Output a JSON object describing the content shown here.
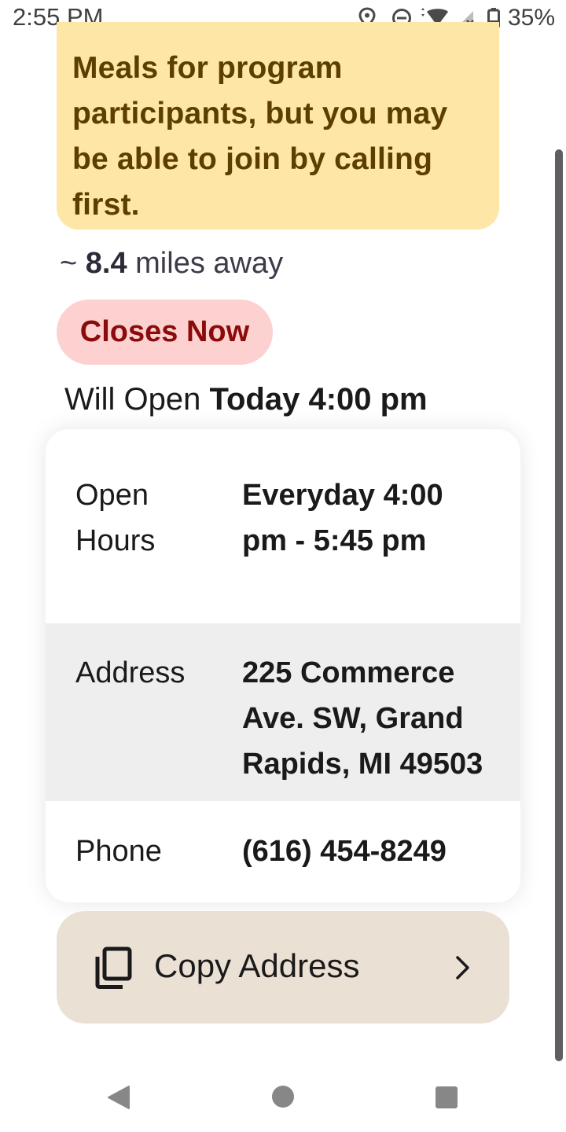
{
  "status_bar": {
    "time": "2:55 PM",
    "battery": "35%",
    "icons": [
      "location-icon",
      "do-not-disturb-icon",
      "wifi-icon",
      "signal-icon",
      "battery-icon"
    ]
  },
  "note": {
    "text": "Meals for program participants, but you may be able to join by calling first."
  },
  "distance": {
    "prefix": "~",
    "value": "8.4",
    "suffix": "miles away"
  },
  "status_badge": {
    "label": "Closes Now"
  },
  "open_info": {
    "prefix": "Will Open",
    "when": "Today 4:00 pm"
  },
  "details": {
    "hours": {
      "label": "Open Hours",
      "value": "Everyday 4:00 pm - 5:45 pm"
    },
    "address": {
      "label": "Address",
      "value": "225 Commerce Ave. SW, Grand Rapids, MI 49503"
    },
    "phone": {
      "label": "Phone",
      "value": "(616) 454-8249"
    }
  },
  "copy_button": {
    "label": "Copy Address",
    "icon": "copy-icon"
  },
  "colors": {
    "note_bg": "#fde6a6",
    "note_text": "#5c3f00",
    "badge_bg": "#fdd1d0",
    "badge_text": "#8a0b0b",
    "button_bg": "#ebe0d4",
    "row_alt_bg": "#eeeeee"
  }
}
